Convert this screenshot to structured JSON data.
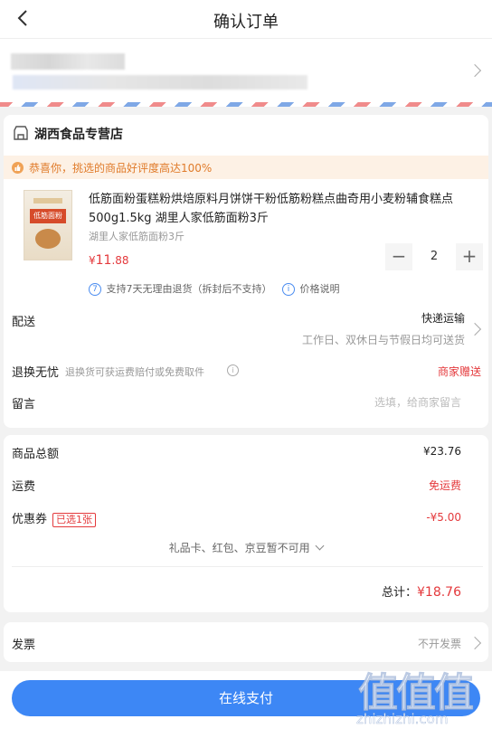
{
  "header": {
    "title": "确认订单"
  },
  "shop": {
    "name": "湖西食品专营店",
    "praise": "恭喜你，挑选的商品好评度高达100%"
  },
  "product": {
    "title": "低筋面粉蛋糕粉烘焙原料月饼饼干粉低筋粉糕点曲奇用小麦粉辅食糕点500g1.5kg 湖里人家低筋面粉3斤",
    "spec": "湖里人家低筋面粉3斤",
    "price_symbol": "¥",
    "price_int": "11",
    "price_dec": ".88",
    "quantity": "2",
    "return_tip": "支持7天无理由退货（拆封后不支持）",
    "price_note": "价格说明",
    "image_label": "低筋面粉"
  },
  "delivery": {
    "label": "配送",
    "method": "快递运输",
    "time": "工作日、双休日与节假日均可送货"
  },
  "return": {
    "label": "退换无忧",
    "desc": "退换货可获运费赔付或免费取件",
    "value": "商家赠送"
  },
  "message": {
    "label": "留言",
    "placeholder": "选填，给商家留言"
  },
  "summary": {
    "goods_label": "商品总额",
    "goods_value": "¥23.76",
    "shipping_label": "运费",
    "shipping_value": "免运费",
    "coupon_label": "优惠券",
    "coupon_tag": "已选1张",
    "coupon_value": "-¥5.00",
    "unavailable": "礼品卡、红包、京豆暂不可用",
    "total_label": "总计：",
    "total_value": "¥18.76"
  },
  "invoice": {
    "label": "发票",
    "value": "不开发票"
  },
  "pay_button": "在线支付",
  "watermark": {
    "big": "值值值",
    "small": "zhizhizhi.com"
  }
}
